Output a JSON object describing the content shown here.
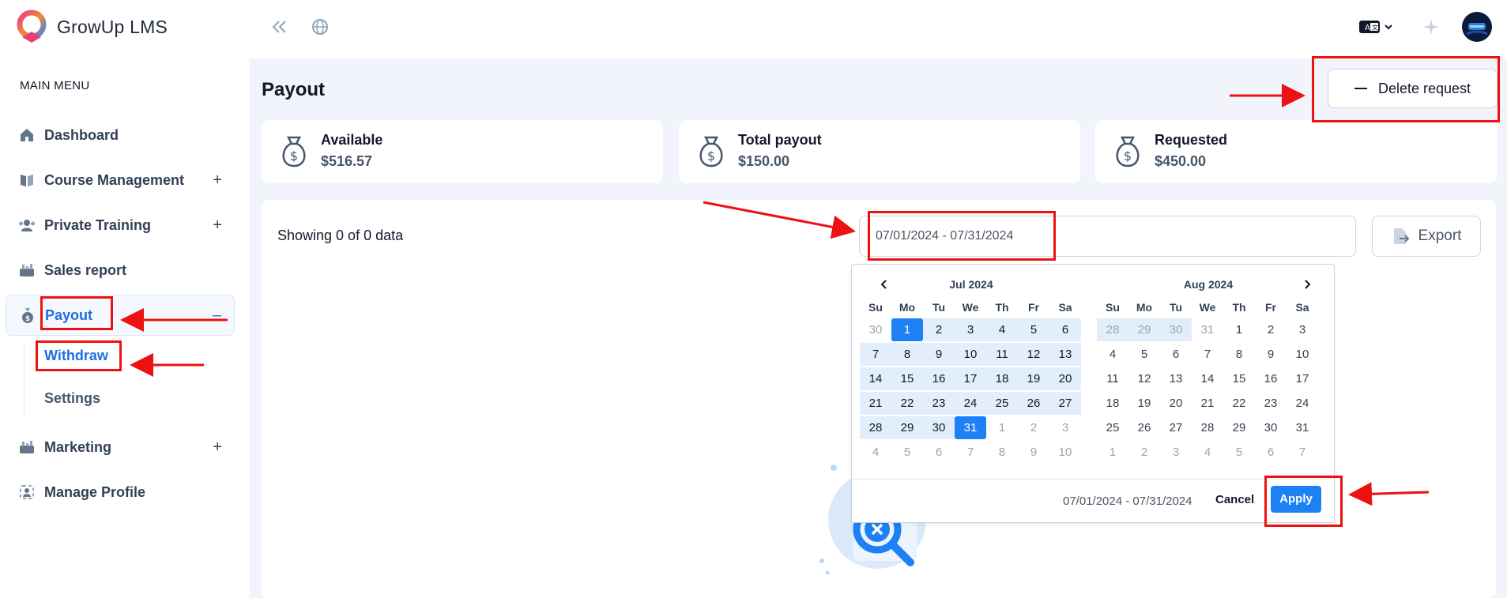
{
  "app": {
    "name": "GrowUp LMS"
  },
  "sidebar": {
    "heading": "MAIN MENU",
    "items": [
      {
        "label": "Dashboard",
        "icon": "home-icon"
      },
      {
        "label": "Course Management",
        "icon": "book-icon",
        "expander": "+"
      },
      {
        "label": "Private Training",
        "icon": "users-icon",
        "expander": "+"
      },
      {
        "label": "Sales report",
        "icon": "report-icon"
      },
      {
        "label": "Payout",
        "icon": "money-bag-icon",
        "expander": "–"
      },
      {
        "label": "Marketing",
        "icon": "marketing-icon",
        "expander": "+"
      },
      {
        "label": "Manage Profile",
        "icon": "profile-icon"
      }
    ],
    "payout_sub": [
      {
        "label": "Withdraw"
      },
      {
        "label": "Settings"
      }
    ]
  },
  "page": {
    "title": "Payout",
    "delete_request_label": "Delete request",
    "stats": [
      {
        "label": "Available",
        "value": "$516.57"
      },
      {
        "label": "Total payout",
        "value": "$150.00"
      },
      {
        "label": "Requested",
        "value": "$450.00"
      }
    ],
    "showing_text": "Showing 0 of 0 data",
    "date_range_value": "07/01/2024 - 07/31/2024",
    "export_label": "Export"
  },
  "picker": {
    "weekdays": [
      "Su",
      "Mo",
      "Tu",
      "We",
      "Th",
      "Fr",
      "Sa"
    ],
    "left_month": "Jul 2024",
    "right_month": "Aug 2024",
    "left_days": [
      [
        "30",
        "1",
        "2",
        "3",
        "4",
        "5",
        "6"
      ],
      [
        "7",
        "8",
        "9",
        "10",
        "11",
        "12",
        "13"
      ],
      [
        "14",
        "15",
        "16",
        "17",
        "18",
        "19",
        "20"
      ],
      [
        "21",
        "22",
        "23",
        "24",
        "25",
        "26",
        "27"
      ],
      [
        "28",
        "29",
        "30",
        "31",
        "1",
        "2",
        "3"
      ],
      [
        "4",
        "5",
        "6",
        "7",
        "8",
        "9",
        "10"
      ]
    ],
    "right_days": [
      [
        "28",
        "29",
        "30",
        "31",
        "1",
        "2",
        "3"
      ],
      [
        "4",
        "5",
        "6",
        "7",
        "8",
        "9",
        "10"
      ],
      [
        "11",
        "12",
        "13",
        "14",
        "15",
        "16",
        "17"
      ],
      [
        "18",
        "19",
        "20",
        "21",
        "22",
        "23",
        "24"
      ],
      [
        "25",
        "26",
        "27",
        "28",
        "29",
        "30",
        "31"
      ],
      [
        "1",
        "2",
        "3",
        "4",
        "5",
        "6",
        "7"
      ]
    ],
    "footer_range": "07/01/2024 - 07/31/2024",
    "cancel_label": "Cancel",
    "apply_label": "Apply"
  },
  "colors": {
    "accent": "#1e80f5",
    "annotation": "#ee1111",
    "main_bg": "#f1f5fb"
  }
}
